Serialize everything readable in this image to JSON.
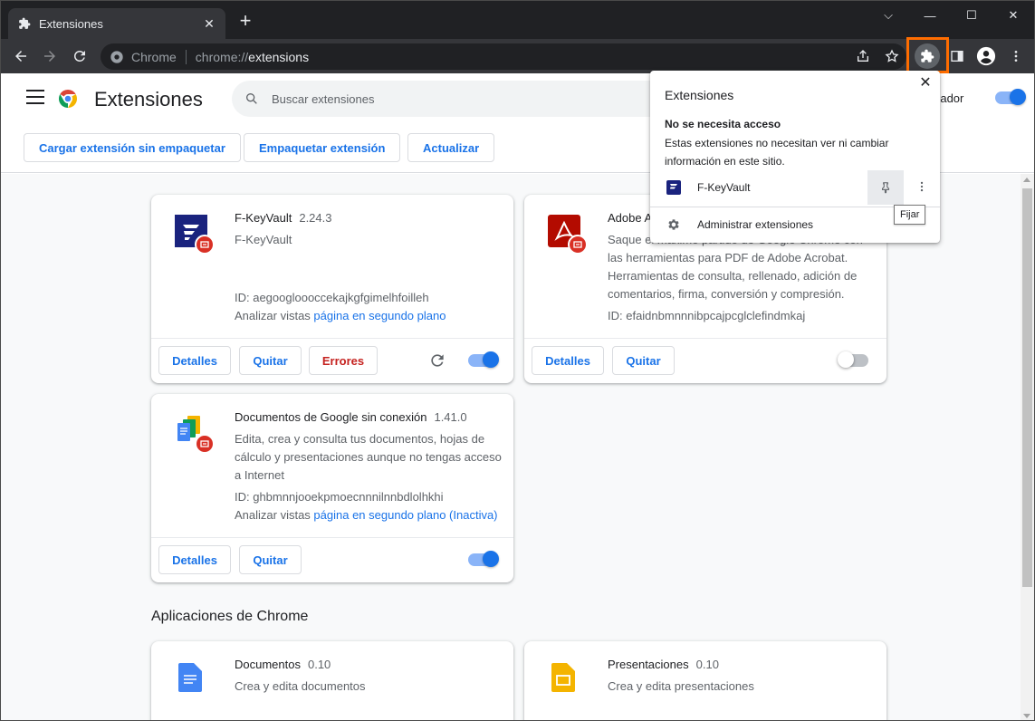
{
  "window": {
    "tab_title": "Extensiones",
    "tab_close": "✕",
    "new_tab": "+",
    "minimize": "—",
    "maximize": "☐",
    "close": "✕",
    "caption_toggle": "⌵"
  },
  "omnibox": {
    "site_label": "Chrome",
    "url_scheme": "chrome://",
    "url_host": "extensions"
  },
  "header": {
    "title": "Extensiones",
    "search_placeholder": "Buscar extensiones",
    "dev_mode_label": "rollador",
    "buttons": {
      "load_unpacked": "Cargar extensión sin empaquetar",
      "pack": "Empaquetar extensión",
      "update": "Actualizar"
    }
  },
  "extensions": [
    {
      "name": "F-KeyVault",
      "version": "2.24.3",
      "description": "F-KeyVault",
      "id_line": "ID: aegoogloooccekajkgfgimelhfoilleh",
      "views_prefix": "Analizar vistas ",
      "views_link": "página en segundo plano",
      "details": "Detalles",
      "remove": "Quitar",
      "errors": "Errores",
      "enabled": true
    },
    {
      "name": "Adobe A",
      "version": "",
      "description": "Saque el máximo partido de Google Chrome con las herramientas para PDF de Adobe Acrobat. Herramientas de consulta, rellenado, adición de comentarios, firma, conversión y compresión.",
      "id_line": "ID: efaidnbmnnnibpcajpcglclefindmkaj",
      "details": "Detalles",
      "remove": "Quitar",
      "enabled": false
    },
    {
      "name": "Documentos de Google sin conexión",
      "version": "1.41.0",
      "description": "Edita, crea y consulta tus documentos, hojas de cálculo y presentaciones aunque no tengas acceso a Internet",
      "id_line": "ID: ghbmnnjooekpmoecnnnilnnbdlolhkhi",
      "views_prefix": "Analizar vistas ",
      "views_link": "página en segundo plano (Inactiva)",
      "details": "Detalles",
      "remove": "Quitar",
      "enabled": true
    }
  ],
  "apps_section": {
    "title": "Aplicaciones de Chrome",
    "apps": [
      {
        "name": "Documentos",
        "version": "0.10",
        "description": "Crea y edita documentos"
      },
      {
        "name": "Presentaciones",
        "version": "0.10",
        "description": "Crea y edita presentaciones"
      }
    ]
  },
  "popup": {
    "title": "Extensiones",
    "close": "✕",
    "heading": "No se necesita acceso",
    "description": "Estas extensiones no necesitan ver ni cambiar información en este sitio.",
    "item_name": "F-KeyVault",
    "manage_label": "Administrar extensiones",
    "pin_tooltip": "Fijar"
  },
  "colors": {
    "accent": "#1a73e8",
    "highlight": "#ff6d00",
    "error": "#c5221f"
  }
}
